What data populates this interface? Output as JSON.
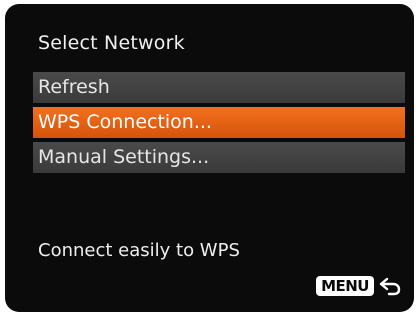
{
  "screen": {
    "title": "Select Network",
    "menu_items": [
      {
        "label": "Refresh",
        "selected": false
      },
      {
        "label": "WPS Connection...",
        "selected": true
      },
      {
        "label": "Manual Settings...",
        "selected": false
      }
    ],
    "hint": "Connect easily to WPS",
    "menu_key_label": "MENU",
    "back_icon": "return-arrow-icon",
    "colors": {
      "background": "#0b0b0b",
      "item_background": "#424242",
      "selected_background": "#e8620f",
      "text": "#ffffff"
    }
  }
}
